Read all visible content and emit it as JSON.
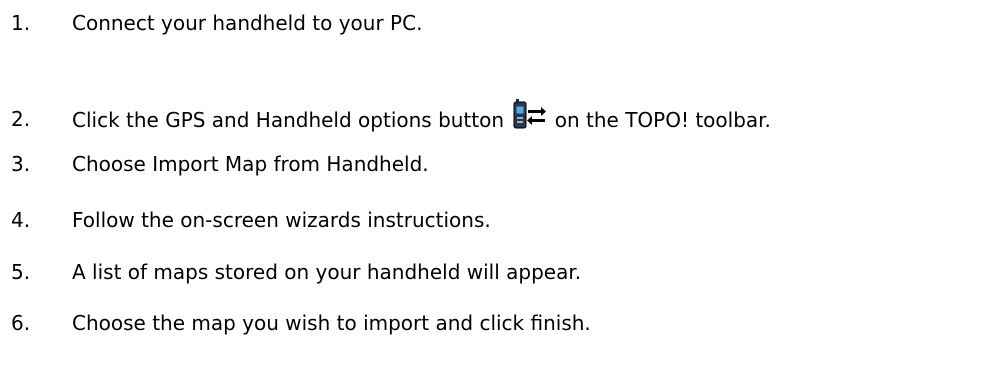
{
  "steps": [
    {
      "number": "1.",
      "text": "Connect your handheld to your PC."
    },
    {
      "number": "2.",
      "text_before": "Click the GPS and Handheld options button",
      "icon": "gps-handheld-options-icon",
      "text_after": "on the TOPO! toolbar."
    },
    {
      "number": "3.",
      "text": "Choose Import Map from Handheld."
    },
    {
      "number": "4.",
      "text": "Follow the on-screen wizards instructions."
    },
    {
      "number": "5.",
      "text": "A list of maps stored on your handheld will appear."
    },
    {
      "number": "6.",
      "text": "Choose the map you wish to import and click finish."
    }
  ]
}
